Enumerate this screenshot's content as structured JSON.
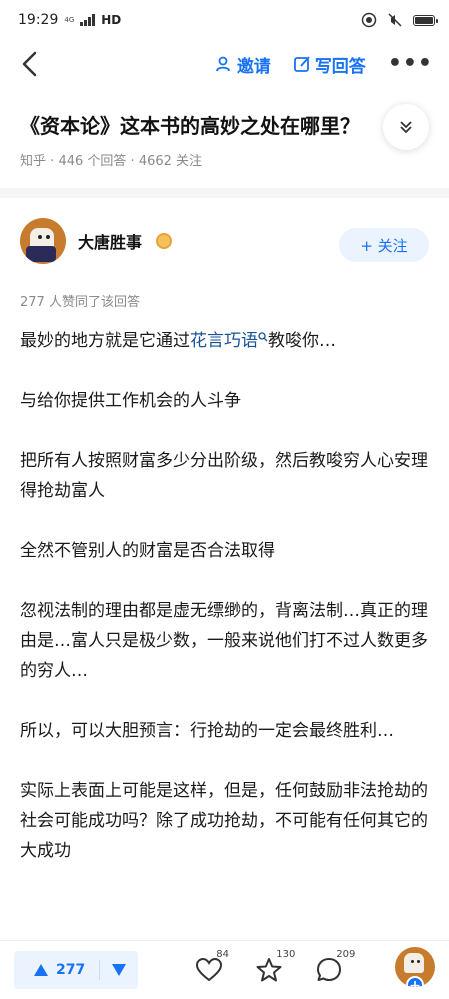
{
  "status_bar": {
    "time": "19:29",
    "network": "HD",
    "signal_tag": "4G"
  },
  "navbar": {
    "invite_label": "邀请",
    "write_answer_label": "写回答",
    "more_label": "•••"
  },
  "question": {
    "title": "《资本论》这本书的高妙之处在哪里？",
    "source": "知乎",
    "answers": "446 个回答",
    "follows": "4662 关注",
    "sep": "·"
  },
  "author": {
    "name": "大唐胜事",
    "follow_label": "+ 关注"
  },
  "answer": {
    "voters": "277 人赞同了该回答",
    "p1_before": "最妙的地方就是它通过",
    "p1_keyword": "花言巧语",
    "p1_after": "教唆你…",
    "p2": "与给你提供工作机会的人斗争",
    "p3": "把所有人按照财富多少分出阶级，然后教唆穷人心安理得抢劫富人",
    "p4": "全然不管别人的财富是否合法取得",
    "p5": "忽视法制的理由都是虚无缥缈的，背离法制…真正的理由是…富人只是极少数，一般来说他们打不过人数更多的穷人…",
    "p6": "所以，可以大胆预言：行抢劫的一定会最终胜利…",
    "p7": "实际上表面上可能是这样，但是，任何鼓励非法抢劫的社会可能成功吗？除了成功抢劫，不可能有任何其它的大成功"
  },
  "bottom_bar": {
    "upvote_count": "277",
    "like_count": "84",
    "favorite_count": "130",
    "comment_count": "209"
  },
  "colors": {
    "accent": "#1772f6",
    "keyword": "#175199",
    "meta": "#8a8a8a"
  },
  "icons": [
    "back-arrow-icon",
    "user-plus-icon",
    "edit-icon",
    "chevron-down-icon",
    "badge-icon",
    "upvote-icon",
    "downvote-icon",
    "heart-icon",
    "star-icon",
    "comment-icon",
    "search-icon"
  ]
}
